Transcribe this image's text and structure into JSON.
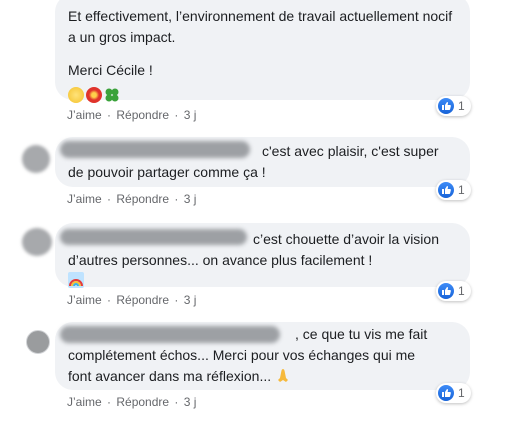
{
  "comments": [
    {
      "text": "Et effectivement, l’environnement de travail actuellement nocif a un gros impact.",
      "text2": "Merci Cécile !",
      "emojis": [
        "sun-emoji",
        "hibiscus-emoji",
        "four-leaf-clover-emoji"
      ],
      "like": "J’aime",
      "reply": "Répondre",
      "time": "3 j",
      "reaction_count": "1"
    },
    {
      "text_line1": "c'est avec plaisir, c'est super",
      "text_line2": "de pouvoir partager comme ça !",
      "like": "J’aime",
      "reply": "Répondre",
      "time": "3 j",
      "reaction_count": "1"
    },
    {
      "text_line1": "c’est chouette d’avoir la vision",
      "text_line2": "d’autres personnes... on avance plus facilement !",
      "emojis": [
        "rainbow-emoji"
      ],
      "like": "J’aime",
      "reply": "Répondre",
      "time": "3 j",
      "reaction_count": "1"
    },
    {
      "text_line1": ", ce que tu vis me fait",
      "text_line2": "complétement échos... Merci pour vos échanges qui me",
      "text_line3": "font avancer dans ma réflexion...",
      "emojis": [
        "folded-hands-emoji"
      ],
      "like": "J’aime",
      "reply": "Répondre",
      "time": "3 j",
      "reaction_count": "1"
    }
  ],
  "colors": {
    "bubble": "#f0f2f5",
    "meta": "#65676b",
    "like_blue": "#1877f2"
  }
}
